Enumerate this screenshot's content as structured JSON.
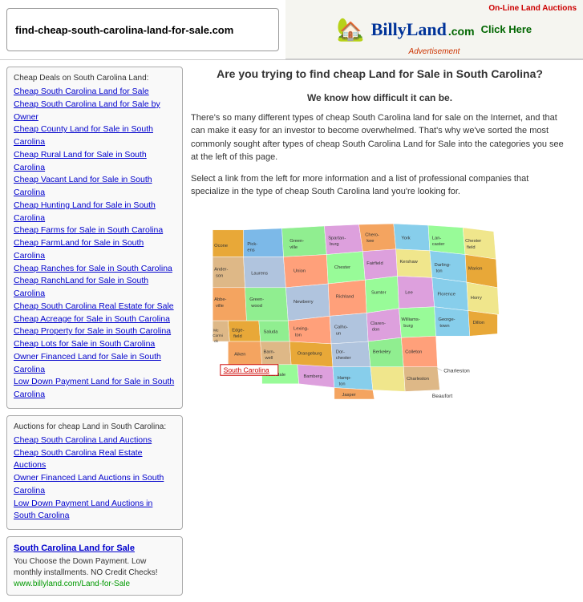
{
  "header": {
    "site_url": "find-cheap-south-carolina-land-for-sale.com",
    "billyland_text": "BillyLand",
    "billyland_com": ".com",
    "online_auction": "On-Line Land Auctions",
    "click_here": "Click Here",
    "advertisement": "Advertisement"
  },
  "sidebar": {
    "deals_title": "Cheap Deals on South Carolina Land:",
    "deals_links": [
      "Cheap South Carolina Land for Sale",
      "Cheap South Carolina Land for Sale by Owner",
      "Cheap County Land for Sale in South Carolina",
      "Cheap Rural Land for Sale in South Carolina",
      "Cheap Vacant Land for Sale in South Carolina",
      "Cheap Hunting Land for Sale in South Carolina",
      "Cheap Farms for Sale in South Carolina",
      "Cheap FarmLand for Sale in South Carolina",
      "Cheap Ranches for Sale in South Carolina",
      "Cheap RanchLand for Sale in South Carolina",
      "Cheap South Carolina Real Estate for Sale",
      "Cheap Acreage for Sale in South Carolina",
      "Cheap Property for Sale in South Carolina",
      "Cheap Lots for Sale in South Carolina",
      "Owner Financed Land for Sale in South Carolina",
      "Low Down Payment Land for Sale in South Carolina"
    ],
    "auctions_title": "Auctions for cheap Land in South Carolina:",
    "auctions_links": [
      "Cheap South Carolina Land Auctions",
      "Cheap South Carolina Real Estate Auctions",
      "Owner Financed Land Auctions in South Carolina",
      "Low Down Payment Land Auctions in South Carolina"
    ],
    "owner_title": "South Carolina Land for Sale",
    "owner_desc": "You Choose the Down Payment. Low monthly installments. NO Credit Checks!",
    "owner_url": "www.billyland.com/Land-for-Sale"
  },
  "content": {
    "heading": "Are you trying to find cheap Land for Sale in South Carolina?",
    "subheading": "We know how difficult it can be.",
    "para1": "There's so many different types of cheap South Carolina land for sale on the Internet, and that can make it easy for an investor to become overwhelmed. That's why we've sorted the most commonly sought after types of cheap South Carolina Land for Sale into the categories you see at the left of this page.",
    "para2": "Select a link from the left for more information and a list of professional companies that specialize in the type of cheap South Carolina land you're looking for.",
    "sc_label": "South Carolina",
    "charleston": "Charleston",
    "beaufort": "Beaufort"
  }
}
